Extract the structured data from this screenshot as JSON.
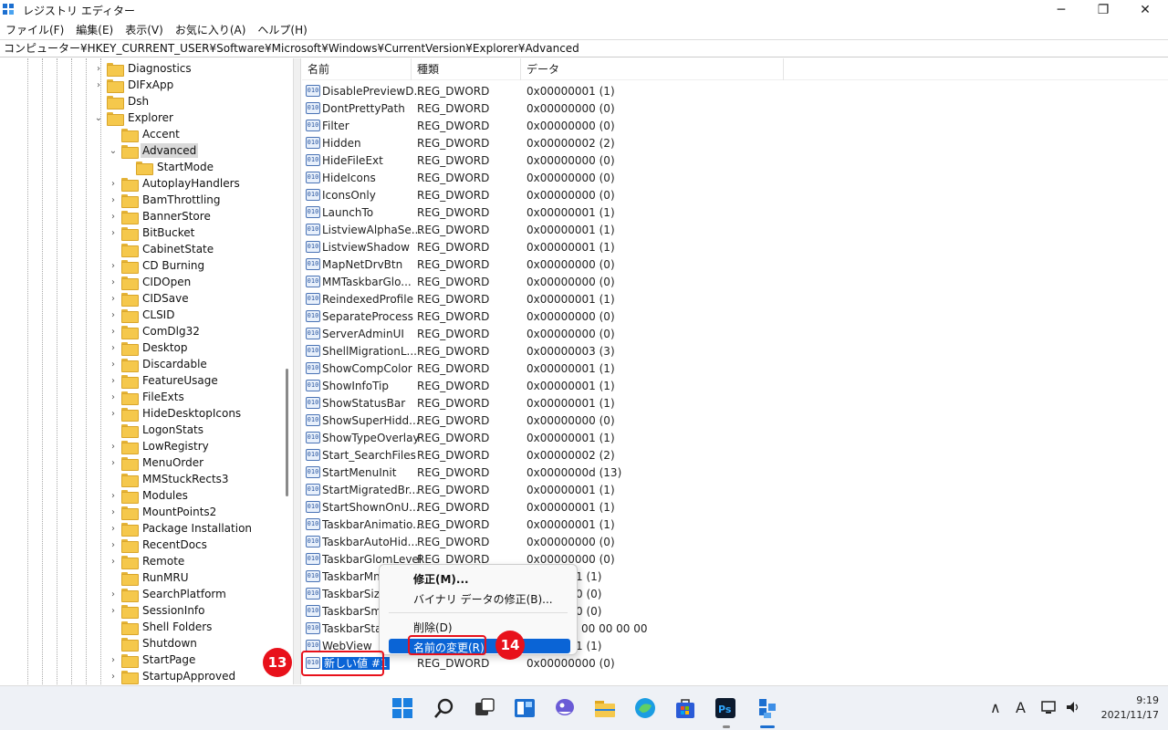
{
  "window": {
    "title": "レジストリ エディター",
    "minimize_glyph": "─",
    "maximize_glyph": "❐",
    "close_glyph": "✕"
  },
  "menu": [
    "ファイル(F)",
    "編集(E)",
    "表示(V)",
    "お気に入り(A)",
    "ヘルプ(H)"
  ],
  "address": "コンピューター¥HKEY_CURRENT_USER¥Software¥Microsoft¥Windows¥CurrentVersion¥Explorer¥Advanced",
  "tree": [
    {
      "label": "Diagnostics",
      "chev": "›"
    },
    {
      "label": "DIFxApp",
      "chev": "›"
    },
    {
      "label": "Dsh",
      "chev": ""
    },
    {
      "label": "Explorer",
      "chev": "⌄"
    },
    {
      "label": "Accent",
      "chev": ""
    },
    {
      "label": "Advanced",
      "chev": "⌄"
    },
    {
      "label": "StartMode",
      "chev": ""
    },
    {
      "label": "AutoplayHandlers",
      "chev": "›"
    },
    {
      "label": "BamThrottling",
      "chev": "›"
    },
    {
      "label": "BannerStore",
      "chev": "›"
    },
    {
      "label": "BitBucket",
      "chev": "›"
    },
    {
      "label": "CabinetState",
      "chev": ""
    },
    {
      "label": "CD Burning",
      "chev": "›"
    },
    {
      "label": "CIDOpen",
      "chev": "›"
    },
    {
      "label": "CIDSave",
      "chev": "›"
    },
    {
      "label": "CLSID",
      "chev": "›"
    },
    {
      "label": "ComDlg32",
      "chev": "›"
    },
    {
      "label": "Desktop",
      "chev": "›"
    },
    {
      "label": "Discardable",
      "chev": "›"
    },
    {
      "label": "FeatureUsage",
      "chev": "›"
    },
    {
      "label": "FileExts",
      "chev": "›"
    },
    {
      "label": "HideDesktopIcons",
      "chev": "›"
    },
    {
      "label": "LogonStats",
      "chev": ""
    },
    {
      "label": "LowRegistry",
      "chev": "›"
    },
    {
      "label": "MenuOrder",
      "chev": "›"
    },
    {
      "label": "MMStuckRects3",
      "chev": ""
    },
    {
      "label": "Modules",
      "chev": "›"
    },
    {
      "label": "MountPoints2",
      "chev": "›"
    },
    {
      "label": "Package Installation",
      "chev": "›"
    },
    {
      "label": "RecentDocs",
      "chev": "›"
    },
    {
      "label": "Remote",
      "chev": "›"
    },
    {
      "label": "RunMRU",
      "chev": ""
    },
    {
      "label": "SearchPlatform",
      "chev": "›"
    },
    {
      "label": "SessionInfo",
      "chev": "›"
    },
    {
      "label": "Shell Folders",
      "chev": ""
    },
    {
      "label": "Shutdown",
      "chev": ""
    },
    {
      "label": "StartPage",
      "chev": "›"
    },
    {
      "label": "StartupApproved",
      "chev": "›"
    }
  ],
  "columns": {
    "name": "名前",
    "type": "種類",
    "data": "データ"
  },
  "values": [
    {
      "name": "DisablePreviewD...",
      "type": "REG_DWORD",
      "data": "0x00000001 (1)"
    },
    {
      "name": "DontPrettyPath",
      "type": "REG_DWORD",
      "data": "0x00000000 (0)"
    },
    {
      "name": "Filter",
      "type": "REG_DWORD",
      "data": "0x00000000 (0)"
    },
    {
      "name": "Hidden",
      "type": "REG_DWORD",
      "data": "0x00000002 (2)"
    },
    {
      "name": "HideFileExt",
      "type": "REG_DWORD",
      "data": "0x00000000 (0)"
    },
    {
      "name": "HideIcons",
      "type": "REG_DWORD",
      "data": "0x00000000 (0)"
    },
    {
      "name": "IconsOnly",
      "type": "REG_DWORD",
      "data": "0x00000000 (0)"
    },
    {
      "name": "LaunchTo",
      "type": "REG_DWORD",
      "data": "0x00000001 (1)"
    },
    {
      "name": "ListviewAlphaSe...",
      "type": "REG_DWORD",
      "data": "0x00000001 (1)"
    },
    {
      "name": "ListviewShadow",
      "type": "REG_DWORD",
      "data": "0x00000001 (1)"
    },
    {
      "name": "MapNetDrvBtn",
      "type": "REG_DWORD",
      "data": "0x00000000 (0)"
    },
    {
      "name": "MMTaskbarGlo...",
      "type": "REG_DWORD",
      "data": "0x00000000 (0)"
    },
    {
      "name": "ReindexedProfile",
      "type": "REG_DWORD",
      "data": "0x00000001 (1)"
    },
    {
      "name": "SeparateProcess",
      "type": "REG_DWORD",
      "data": "0x00000000 (0)"
    },
    {
      "name": "ServerAdminUI",
      "type": "REG_DWORD",
      "data": "0x00000000 (0)"
    },
    {
      "name": "ShellMigrationL...",
      "type": "REG_DWORD",
      "data": "0x00000003 (3)"
    },
    {
      "name": "ShowCompColor",
      "type": "REG_DWORD",
      "data": "0x00000001 (1)"
    },
    {
      "name": "ShowInfoTip",
      "type": "REG_DWORD",
      "data": "0x00000001 (1)"
    },
    {
      "name": "ShowStatusBar",
      "type": "REG_DWORD",
      "data": "0x00000001 (1)"
    },
    {
      "name": "ShowSuperHidd...",
      "type": "REG_DWORD",
      "data": "0x00000000 (0)"
    },
    {
      "name": "ShowTypeOverlay",
      "type": "REG_DWORD",
      "data": "0x00000001 (1)"
    },
    {
      "name": "Start_SearchFiles",
      "type": "REG_DWORD",
      "data": "0x00000002 (2)"
    },
    {
      "name": "StartMenuInit",
      "type": "REG_DWORD",
      "data": "0x0000000d (13)"
    },
    {
      "name": "StartMigratedBr...",
      "type": "REG_DWORD",
      "data": "0x00000001 (1)"
    },
    {
      "name": "StartShownOnU...",
      "type": "REG_DWORD",
      "data": "0x00000001 (1)"
    },
    {
      "name": "TaskbarAnimatio...",
      "type": "REG_DWORD",
      "data": "0x00000001 (1)"
    },
    {
      "name": "TaskbarAutoHid...",
      "type": "REG_DWORD",
      "data": "0x00000000 (0)"
    },
    {
      "name": "TaskbarGlomLevel",
      "type": "REG_DWORD",
      "data": "0x00000000 (0)"
    },
    {
      "name": "TaskbarMn",
      "type": "",
      "data": "1 (1)"
    },
    {
      "name": "TaskbarSizeM",
      "type": "",
      "data": "0 (0)"
    },
    {
      "name": "TaskbarSma",
      "type": "",
      "data": "0 (0)"
    },
    {
      "name": "TaskbarState",
      "type": "",
      "data": "00 00 00 00"
    },
    {
      "name": "WebView",
      "type": "",
      "data": "1 (1)"
    },
    {
      "name": "新しい値 #1",
      "type": "REG_DWORD",
      "data": "0x00000000 (0)"
    }
  ],
  "context_menu": {
    "modify": "修正(M)...",
    "modify_binary": "バイナリ データの修正(B)...",
    "delete": "削除(D)",
    "rename": "名前の変更(R)"
  },
  "callouts": {
    "step13": "13",
    "step14": "14"
  },
  "clock": {
    "time": "9:19",
    "date": "2021/11/17"
  },
  "tray": {
    "chevron": "∧",
    "ime": "A"
  },
  "colors": {
    "accent": "#0a64d6",
    "callout_red": "#e8111b",
    "folder": "#f5c84c"
  }
}
